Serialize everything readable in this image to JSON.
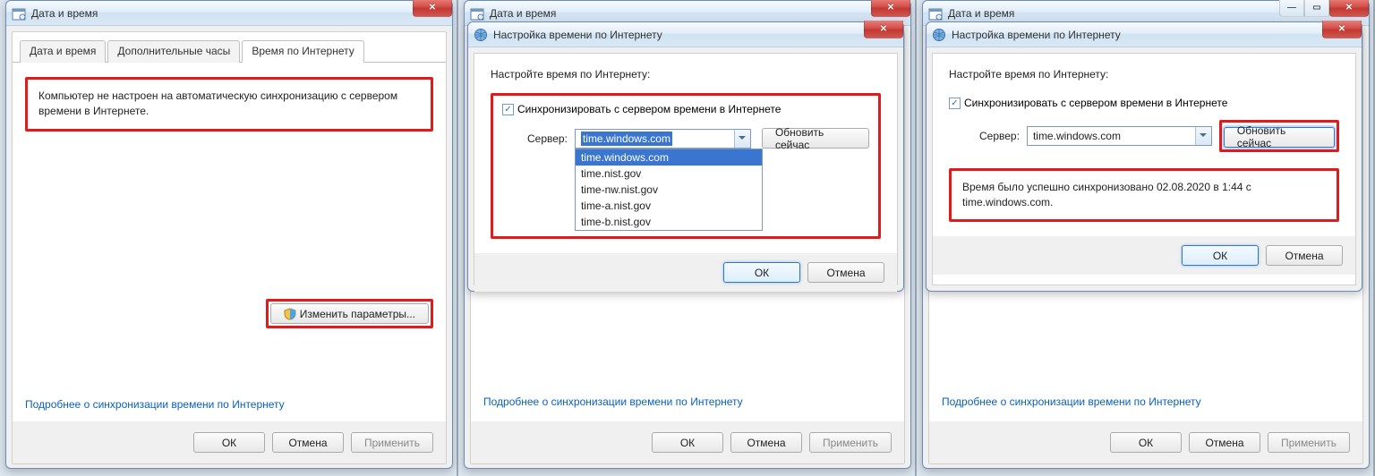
{
  "parent_window": {
    "title": "Дата и время",
    "tabs": [
      "Дата и время",
      "Дополнительные часы",
      "Время по Интернету"
    ],
    "active_tab_index": 2,
    "not_configured_text": "Компьютер не настроен на автоматическую синхронизацию с сервером времени в Интернете.",
    "change_params_button": "Изменить параметры...",
    "more_info_link": "Подробнее о синхронизации времени по Интернету",
    "ok": "ОК",
    "cancel": "Отмена",
    "apply": "Применить"
  },
  "dialog": {
    "title": "Настройка времени по Интернету",
    "heading": "Настройте время по Интернету:",
    "sync_checkbox_label": "Синхронизировать с сервером времени в Интернете",
    "sync_checked": true,
    "server_label": "Сервер:",
    "server_value": "time.windows.com",
    "server_options": [
      "time.windows.com",
      "time.nist.gov",
      "time-nw.nist.gov",
      "time-a.nist.gov",
      "time-b.nist.gov"
    ],
    "update_now": "Обновить сейчас",
    "ok": "ОК",
    "cancel": "Отмена",
    "success_message": "Время было успешно синхронизовано 02.08.2020 в 1:44 с time.windows.com."
  }
}
